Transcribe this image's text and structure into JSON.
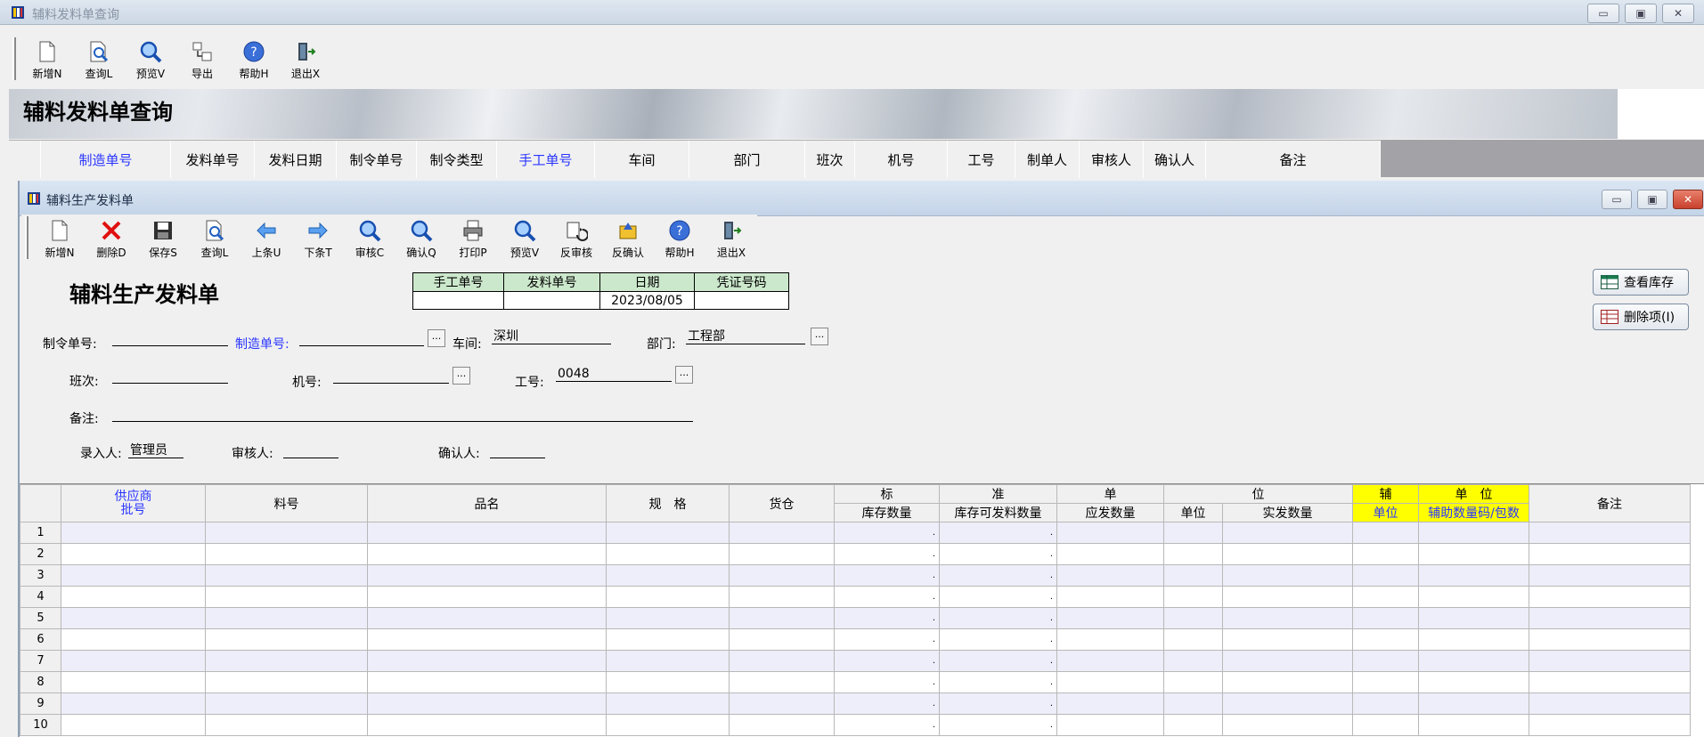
{
  "outer": {
    "title": "辅料发料单查询",
    "toolbar": [
      {
        "label": "新增N",
        "icon": "new-doc-icon"
      },
      {
        "label": "查询L",
        "icon": "query-icon"
      },
      {
        "label": "预览V",
        "icon": "preview-icon"
      },
      {
        "label": "导出",
        "icon": "export-icon"
      },
      {
        "label": "帮助H",
        "icon": "help-icon"
      },
      {
        "label": "退出X",
        "icon": "exit-icon"
      }
    ],
    "banner_title": "辅料发料单查询",
    "columns": [
      {
        "label": "制造单号",
        "highlight": true
      },
      {
        "label": "发料单号",
        "highlight": false
      },
      {
        "label": "发料日期",
        "highlight": false
      },
      {
        "label": "制令单号",
        "highlight": false
      },
      {
        "label": "制令类型",
        "highlight": false
      },
      {
        "label": "手工单号",
        "highlight": true
      },
      {
        "label": "车间",
        "highlight": false
      },
      {
        "label": "部门",
        "highlight": false
      },
      {
        "label": "班次",
        "highlight": false
      },
      {
        "label": "机号",
        "highlight": false
      },
      {
        "label": "工号",
        "highlight": false
      },
      {
        "label": "制单人",
        "highlight": false
      },
      {
        "label": "审核人",
        "highlight": false
      },
      {
        "label": "确认人",
        "highlight": false
      },
      {
        "label": "备注",
        "highlight": false
      }
    ]
  },
  "inner": {
    "title": "辅料生产发料单",
    "toolbar": [
      {
        "label": "新增N",
        "icon": "new-doc-icon"
      },
      {
        "label": "删除D",
        "icon": "delete-icon"
      },
      {
        "label": "保存S",
        "icon": "save-icon"
      },
      {
        "label": "查询L",
        "icon": "query-icon"
      },
      {
        "label": "上条U",
        "icon": "prev-arrow-icon"
      },
      {
        "label": "下条T",
        "icon": "next-arrow-icon"
      },
      {
        "label": "审核C",
        "icon": "audit-icon"
      },
      {
        "label": "确认Q",
        "icon": "confirm-icon"
      },
      {
        "label": "打印P",
        "icon": "print-icon"
      },
      {
        "label": "预览V",
        "icon": "preview-icon"
      },
      {
        "label": "反审核",
        "icon": "unaudit-icon"
      },
      {
        "label": "反确认",
        "icon": "unconfirm-icon"
      },
      {
        "label": "帮助H",
        "icon": "help-icon"
      },
      {
        "label": "退出X",
        "icon": "exit-icon"
      }
    ],
    "doc_title": "辅料生产发料单",
    "header_grid": {
      "labels": [
        "手工单号",
        "发料单号",
        "日期",
        "凭证号码"
      ],
      "values": [
        "",
        "",
        "2023/08/05",
        ""
      ]
    },
    "side_buttons": {
      "stock": "查看库存",
      "delete_item": "删除项(I)"
    },
    "form": {
      "order_no_label": "制令单号:",
      "order_no": "",
      "mfg_no_label": "制造单号:",
      "mfg_no": "",
      "workshop_label": "车间:",
      "workshop": "深圳",
      "dept_label": "部门:",
      "dept": "工程部",
      "shift_label": "班次:",
      "shift": "",
      "machine_label": "机号:",
      "machine": "",
      "worker_label": "工号:",
      "worker": "0048",
      "remark_label": "备注:",
      "remark": "",
      "entered_by_label": "录入人:",
      "entered_by": "管理员",
      "audited_by_label": "审核人:",
      "audited_by": "",
      "confirmed_by_label": "确认人:",
      "confirmed_by": ""
    },
    "grid": {
      "h_supplier": "供应商",
      "h_batch": "批号",
      "h_item_no": "料号",
      "h_item_name": "品名",
      "h_spec": "规　格",
      "h_warehouse": "货仓",
      "h_std": [
        "标",
        "准",
        "单",
        "位"
      ],
      "h_stock_qty": "库存数量",
      "h_avail_qty": "库存可发料数量",
      "h_due_qty": "应发数量",
      "h_unit": "单位",
      "h_actual_qty": "实发数量",
      "h_aux": "辅",
      "h_aux_unit_top": "单　位",
      "h_aux_unit": "单位",
      "h_aux_qty": "辅助数量码/包数",
      "h_remark": "备注",
      "rows": [
        "1",
        "2",
        "3",
        "4",
        "5",
        "6",
        "7",
        "8",
        "9",
        "10"
      ],
      "dot": "."
    }
  }
}
